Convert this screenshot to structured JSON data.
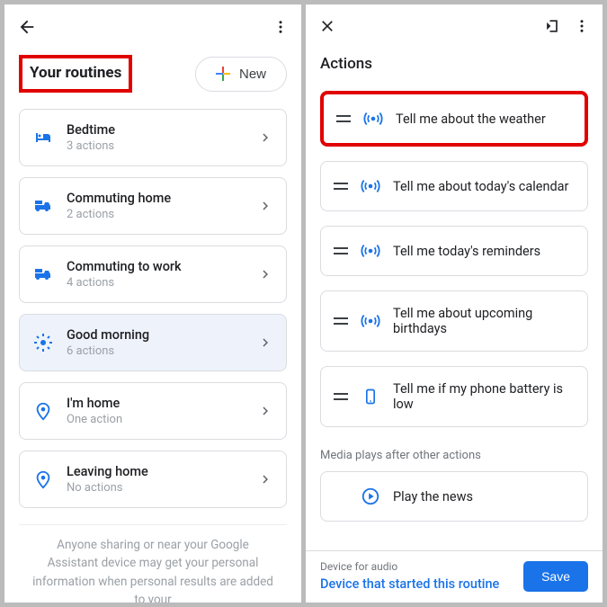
{
  "left": {
    "title": "Your routines",
    "new_button": "New",
    "routines": [
      {
        "icon": "bed",
        "name": "Bedtime",
        "sub": "3 actions",
        "selected": false
      },
      {
        "icon": "vehicle",
        "name": "Commuting home",
        "sub": "2 actions",
        "selected": false
      },
      {
        "icon": "vehicle",
        "name": "Commuting to work",
        "sub": "4 actions",
        "selected": false
      },
      {
        "icon": "sun",
        "name": "Good morning",
        "sub": "6 actions",
        "selected": true
      },
      {
        "icon": "pin",
        "name": "I'm home",
        "sub": "One action",
        "selected": false
      },
      {
        "icon": "pin",
        "name": "Leaving home",
        "sub": "No actions",
        "selected": false
      }
    ],
    "footnote": "Anyone sharing or near your Google Assistant device may get your personal information when personal results are added to your"
  },
  "right": {
    "section": "Actions",
    "actions": [
      {
        "icon": "broadcast",
        "label": "Tell me about the weather",
        "highlight": true
      },
      {
        "icon": "broadcast",
        "label": "Tell me about today's calendar",
        "highlight": false
      },
      {
        "icon": "broadcast",
        "label": "Tell me today's reminders",
        "highlight": false
      },
      {
        "icon": "broadcast",
        "label": "Tell me about upcoming birthdays",
        "highlight": false
      },
      {
        "icon": "phone",
        "label": "Tell me if my phone battery is low",
        "highlight": false
      }
    ],
    "media_header": "Media plays after other actions",
    "media_item": "Play the news",
    "bottom": {
      "label": "Device for audio",
      "link": "Device that started this routine",
      "save": "Save"
    }
  }
}
